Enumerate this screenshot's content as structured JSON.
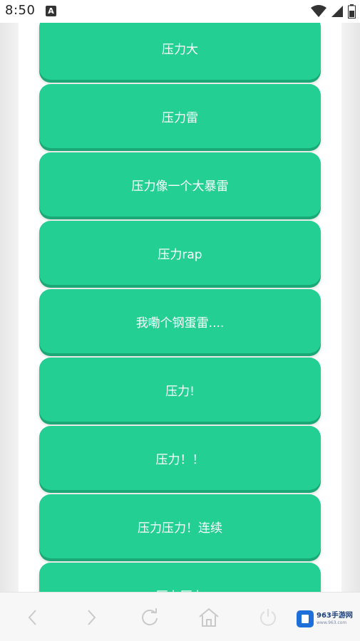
{
  "status_bar": {
    "time": "8:50",
    "notification_icon": "A",
    "icons": [
      "wifi-icon",
      "signal-icon",
      "battery-icon"
    ]
  },
  "buttons": [
    {
      "label": "压力大"
    },
    {
      "label": "压力雷"
    },
    {
      "label": "压力像一个大暴雷"
    },
    {
      "label": "压力rap"
    },
    {
      "label": "我嘞个钢蛋雷...."
    },
    {
      "label": "压力!"
    },
    {
      "label": "压力！！"
    },
    {
      "label": "压力压力！连续"
    },
    {
      "label": "压力压力"
    }
  ],
  "nav_bar": {
    "items": [
      "back-icon",
      "forward-icon",
      "refresh-icon",
      "home-icon",
      "power-icon"
    ]
  },
  "watermark": {
    "text": "963手游网",
    "sub": "www.963.com"
  },
  "colors": {
    "button_green": "#23cf93",
    "button_shadow": "#1aa876",
    "button_text": "#ffffff"
  }
}
